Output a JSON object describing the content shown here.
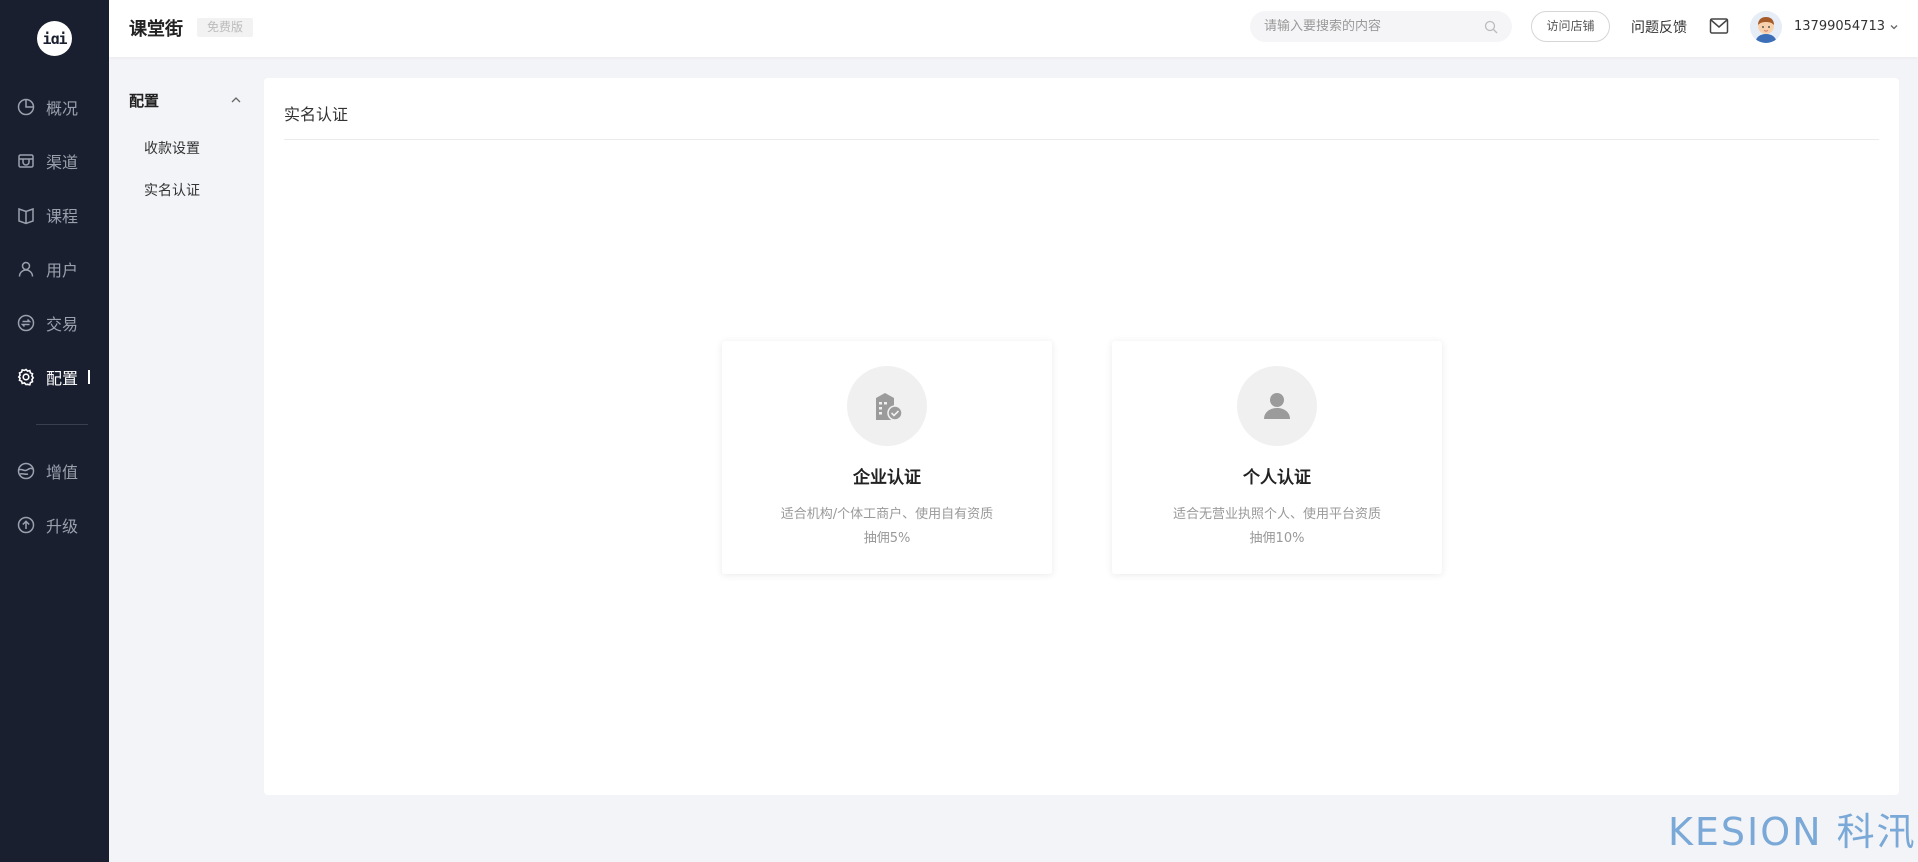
{
  "sidebar": {
    "logo_text": "iɑi",
    "items": [
      {
        "label": "概况",
        "icon": "pie-chart-icon"
      },
      {
        "label": "渠道",
        "icon": "store-icon"
      },
      {
        "label": "课程",
        "icon": "book-icon"
      },
      {
        "label": "用户",
        "icon": "user-icon"
      },
      {
        "label": "交易",
        "icon": "exchange-icon"
      },
      {
        "label": "配置",
        "icon": "gear-icon",
        "active": true
      },
      {
        "label": "增值",
        "icon": "globe-icon"
      },
      {
        "label": "升级",
        "icon": "arrow-up-circle-icon"
      }
    ]
  },
  "header": {
    "brand": "课堂街",
    "edition": "免费版",
    "search_placeholder": "请输入要搜索的内容",
    "visit_store": "访问店铺",
    "feedback": "问题反馈",
    "user_phone": "13799054713"
  },
  "submenu": {
    "title": "配置",
    "items": [
      "收款设置",
      "实名认证"
    ]
  },
  "main": {
    "title": "实名认证",
    "options": [
      {
        "title": "企业认证",
        "desc_line1": "适合机构/个体工商户、使用自有资质",
        "desc_line2": "抽佣5%",
        "icon": "building-verified-icon"
      },
      {
        "title": "个人认证",
        "desc_line1": "适合无营业执照个人、使用平台资质",
        "desc_line2": "抽佣10%",
        "icon": "person-icon"
      }
    ]
  },
  "watermark": "KESION 科汛",
  "colors": {
    "sidebar_bg": "#1a1f30",
    "page_bg": "#f3f4f8",
    "watermark": "#6da0d4"
  }
}
